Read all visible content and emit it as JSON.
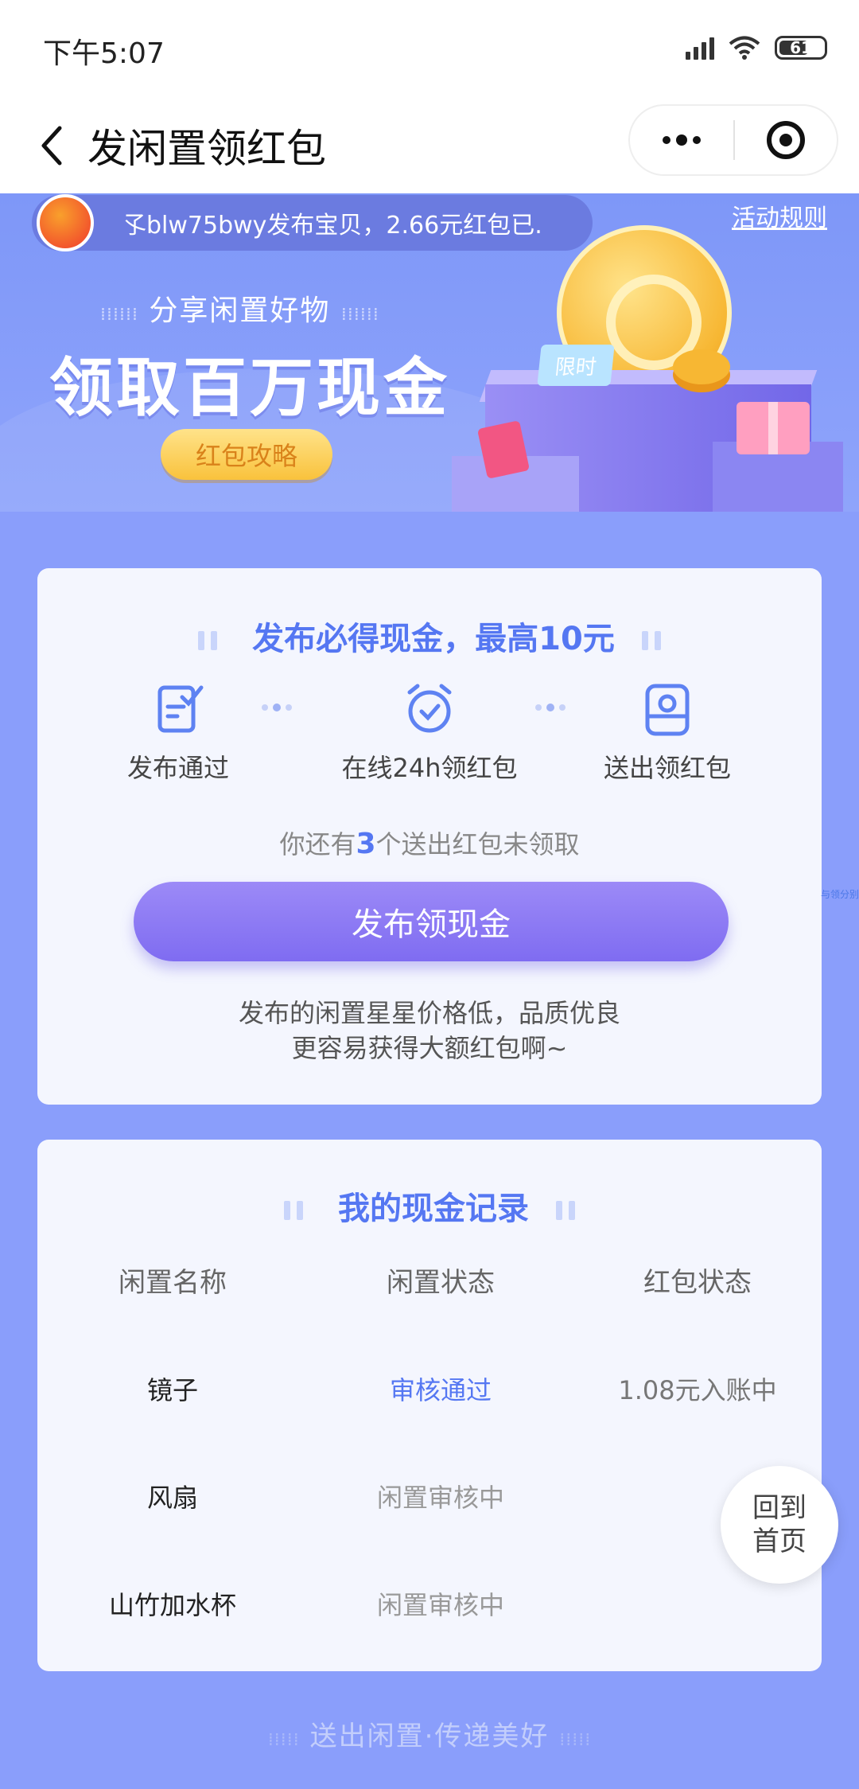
{
  "status_bar": {
    "time": "下午5:07",
    "battery": "61",
    "icons": [
      "signal-icon",
      "wifi-icon",
      "battery-icon"
    ]
  },
  "nav": {
    "title": "发闲置领红包",
    "back_icon": "chevron-left-icon",
    "more_icon": "more-dots-icon",
    "close_icon": "target-circle-icon"
  },
  "banner": {
    "ticker_text": "孓blw75bwy发布宝贝，2.66元红包已.",
    "rules_link": "活动规则",
    "subtitle": "分享闲置好物",
    "title": "领取百万现金",
    "strategy_button": "红包攻略",
    "limit_tag": "限时"
  },
  "card1": {
    "title": "发布必得现金，最高10元",
    "steps": [
      {
        "label": "发布通过",
        "icon": "edit-doc-icon"
      },
      {
        "label": "在线24h领红包",
        "icon": "alarm-clock-icon"
      },
      {
        "label": "送出领红包",
        "icon": "box-icon"
      }
    ],
    "pending_prefix": "你还有",
    "pending_count": "3",
    "pending_suffix": "个送出红包未领取",
    "publish_button": "发布领现金",
    "tip_line1": "发布的闲置星星价格低，品质优良",
    "tip_line2": "更容易获得大额红包啊~"
  },
  "card2": {
    "title": "我的现金记录",
    "columns": [
      "闲置名称",
      "闲置状态",
      "红包状态"
    ],
    "rows": [
      {
        "name": "镜子",
        "status": "审核通过",
        "redpacket": "1.08元入账中"
      },
      {
        "name": "风扇",
        "status": "闲置审核中",
        "redpacket": ""
      },
      {
        "name": "山竹加水杯",
        "status": "闲置审核中",
        "redpacket": ""
      }
    ]
  },
  "home_button": {
    "line1": "回到",
    "line2": "首页"
  },
  "footer_slogan": "送出闲置·传递美好",
  "side_tiny_text": "与领分别",
  "colors": {
    "accent": "#5577F2",
    "background": "#8A9EFB",
    "button": "#8A78F3",
    "gold": "#F7B733"
  }
}
